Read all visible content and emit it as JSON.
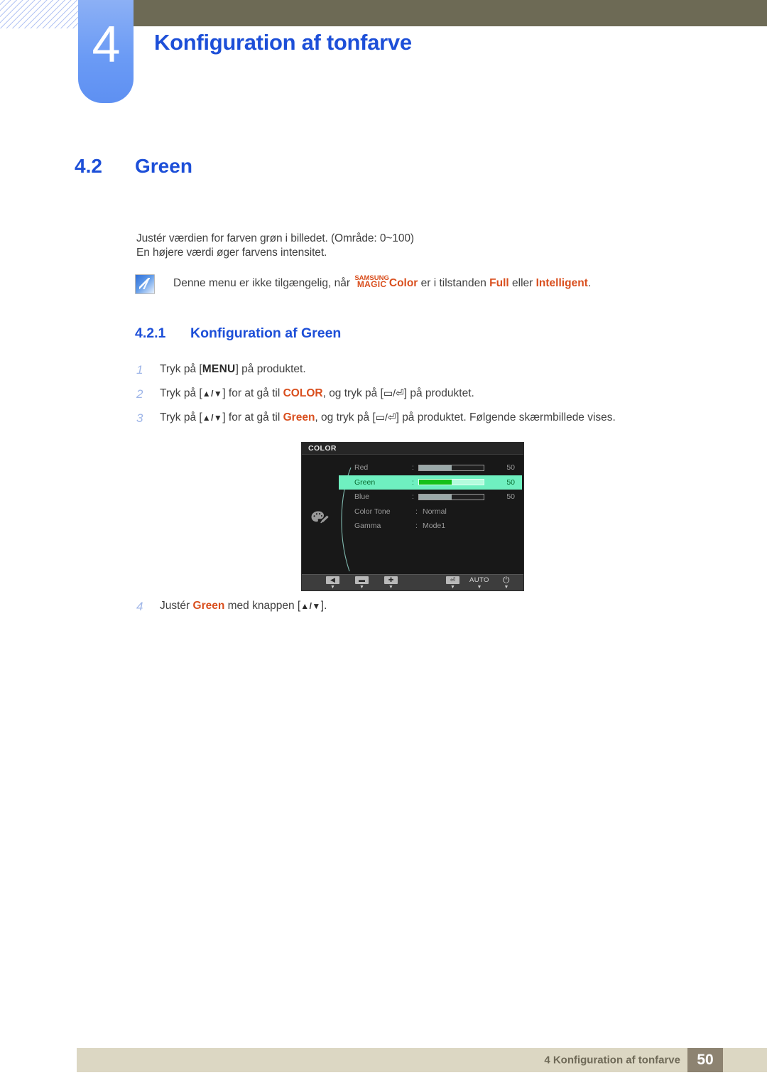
{
  "header": {
    "chapter_number": "4",
    "chapter_title": "Konfiguration af tonfarve"
  },
  "section": {
    "number": "4.2",
    "title": "Green"
  },
  "body": {
    "paragraph_1": "Justér værdien for farven grøn i billedet. (Område: 0~100)",
    "paragraph_2": "En højere værdi øger farvens intensitet."
  },
  "note": {
    "icon": "note-pencil-icon",
    "text_before": "Denne menu er ikke tilgængelig, når ",
    "magic_line1": "SAMSUNG",
    "magic_line2": "MAGIC",
    "magic_suffix": "Color",
    "text_middle": " er i tilstanden ",
    "emph_1": "Full",
    "text_between": " eller ",
    "emph_2": "Intelligent",
    "text_end": "."
  },
  "subsection": {
    "number": "4.2.1",
    "title": "Konfiguration af Green"
  },
  "steps": [
    {
      "n": "1",
      "pre": "Tryk på [",
      "kbd": "MENU",
      "post": "] på produktet."
    },
    {
      "n": "2",
      "pre": "Tryk på [",
      "arrows": "▲/▼",
      "mid": "] for at gå til ",
      "emph": "COLOR",
      "mid2": ", og tryk på [",
      "glyph": "▭/⏎",
      "post": "] på produktet."
    },
    {
      "n": "3",
      "pre": "Tryk på [",
      "arrows": "▲/▼",
      "mid": "] for at gå til ",
      "emph": "Green",
      "mid2": ", og tryk på [",
      "glyph": "▭/⏎",
      "post": "] på produktet. Følgende skærmbillede vises."
    },
    {
      "n": "4",
      "pre": "Justér ",
      "emph": "Green",
      "mid": " med knappen [",
      "arrows": "▲/▼",
      "post": "]."
    }
  ],
  "osd": {
    "title": "COLOR",
    "icon": "palette-icon",
    "rows": [
      {
        "label": "Red",
        "colon": ":",
        "type": "bar",
        "fill_pct": 50,
        "value": "50",
        "highlighted": false
      },
      {
        "label": "Green",
        "colon": ":",
        "type": "bar",
        "fill_pct": 50,
        "value": "50",
        "highlighted": true
      },
      {
        "label": "Blue",
        "colon": ":",
        "type": "bar",
        "fill_pct": 50,
        "value": "50",
        "highlighted": false
      },
      {
        "label": "Color Tone",
        "colon": ":",
        "type": "text",
        "value": "Normal",
        "highlighted": false
      },
      {
        "label": "Gamma",
        "colon": ":",
        "type": "text",
        "value": "Mode1",
        "highlighted": false
      }
    ],
    "footer_buttons": [
      {
        "name": "back-button",
        "glyph": "◀",
        "kind": "box"
      },
      {
        "name": "minus-button",
        "glyph": "▬",
        "kind": "box"
      },
      {
        "name": "plus-button",
        "glyph": "✚",
        "kind": "box"
      },
      {
        "name": "enter-button",
        "glyph": "⏎",
        "kind": "box"
      },
      {
        "name": "auto-button",
        "glyph": "AUTO",
        "kind": "text"
      },
      {
        "name": "power-button",
        "glyph": "⏻",
        "kind": "text"
      }
    ]
  },
  "footer": {
    "text": "4 Konfiguration af tonfarve",
    "page": "50"
  },
  "colors": {
    "accent_blue": "#1d4fd8",
    "olive": "#6d6a55",
    "orange": "#d94f1e",
    "footer_bar": "#dcd7c3",
    "footer_page_bg": "#8d8371",
    "osd_highlight": "#6ff0c0"
  }
}
